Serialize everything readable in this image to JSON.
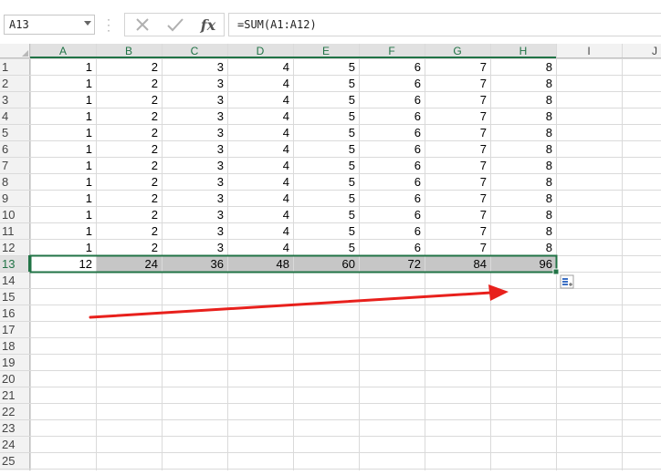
{
  "name_box": {
    "value": "A13"
  },
  "formula_bar": {
    "formula": "=SUM(A1:A12)",
    "fx_label": "fx"
  },
  "columns": [
    "A",
    "B",
    "C",
    "D",
    "E",
    "F",
    "G",
    "H",
    "I",
    "J"
  ],
  "rows": [
    "1",
    "2",
    "3",
    "4",
    "5",
    "6",
    "7",
    "8",
    "9",
    "10",
    "11",
    "12",
    "13",
    "14",
    "15",
    "16",
    "17",
    "18",
    "19",
    "20",
    "21",
    "22",
    "23",
    "24",
    "25"
  ],
  "data_rows": [
    [
      "1",
      "2",
      "3",
      "4",
      "5",
      "6",
      "7",
      "8"
    ],
    [
      "1",
      "2",
      "3",
      "4",
      "5",
      "6",
      "7",
      "8"
    ],
    [
      "1",
      "2",
      "3",
      "4",
      "5",
      "6",
      "7",
      "8"
    ],
    [
      "1",
      "2",
      "3",
      "4",
      "5",
      "6",
      "7",
      "8"
    ],
    [
      "1",
      "2",
      "3",
      "4",
      "5",
      "6",
      "7",
      "8"
    ],
    [
      "1",
      "2",
      "3",
      "4",
      "5",
      "6",
      "7",
      "8"
    ],
    [
      "1",
      "2",
      "3",
      "4",
      "5",
      "6",
      "7",
      "8"
    ],
    [
      "1",
      "2",
      "3",
      "4",
      "5",
      "6",
      "7",
      "8"
    ],
    [
      "1",
      "2",
      "3",
      "4",
      "5",
      "6",
      "7",
      "8"
    ],
    [
      "1",
      "2",
      "3",
      "4",
      "5",
      "6",
      "7",
      "8"
    ],
    [
      "1",
      "2",
      "3",
      "4",
      "5",
      "6",
      "7",
      "8"
    ],
    [
      "1",
      "2",
      "3",
      "4",
      "5",
      "6",
      "7",
      "8"
    ]
  ],
  "totals_row": [
    "12",
    "24",
    "36",
    "48",
    "60",
    "72",
    "84",
    "96"
  ],
  "selection": {
    "active_cell": "A13",
    "range": "A13:H13"
  },
  "colors": {
    "accent": "#217346",
    "arrow": "#e8201c",
    "grid": "#dadada",
    "header_bg": "#f2f2f2",
    "selected_header_bg": "#e1e1e1",
    "selected_fill": "#c6c6c6"
  },
  "annotation": {
    "type": "arrow"
  },
  "icons": {
    "cancel": "cancel-x-icon",
    "enter": "enter-check-icon",
    "quick_analysis": "quick-analysis-icon"
  }
}
